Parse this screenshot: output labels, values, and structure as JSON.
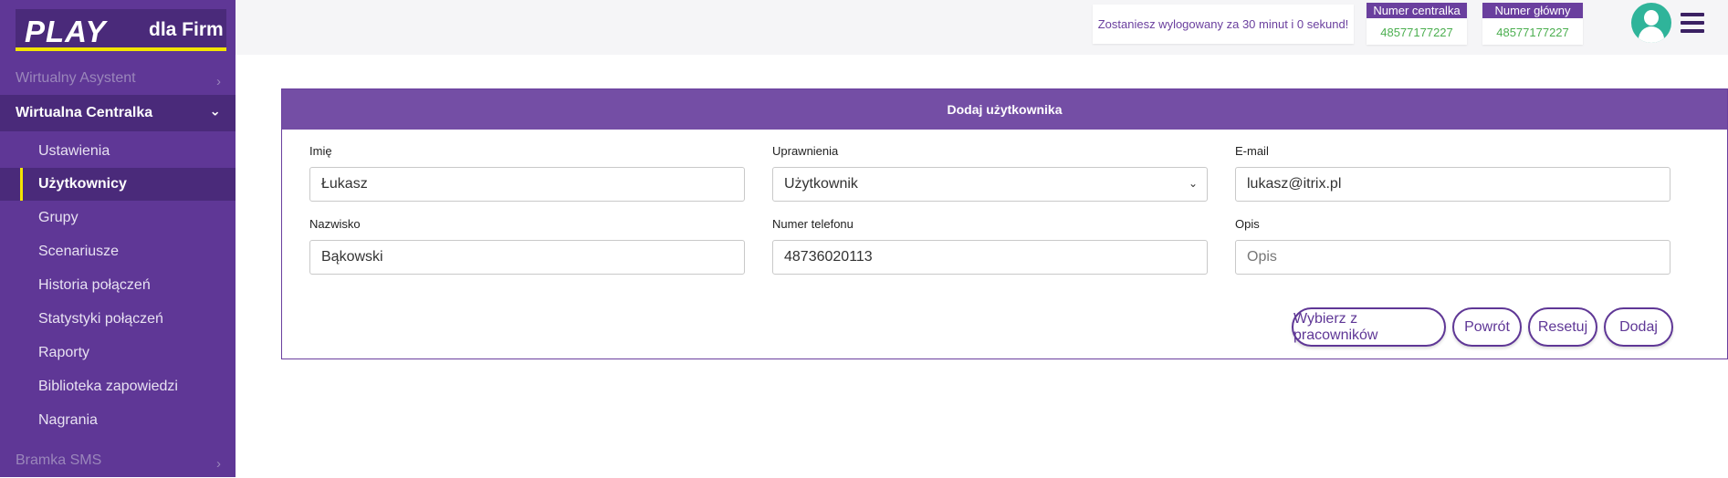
{
  "brand": {
    "name": "PLAY",
    "suffix": "dla Firm",
    "accent": "#f2e400",
    "primary": "#5f3796"
  },
  "sidebar": {
    "items": [
      {
        "label": "Wirtualny Asystent",
        "state": "dim"
      },
      {
        "label": "Wirtualna Centralka",
        "state": "expanded"
      }
    ],
    "subitems": [
      {
        "label": "Ustawienia"
      },
      {
        "label": "Użytkownicy",
        "selected": true
      },
      {
        "label": "Grupy"
      },
      {
        "label": "Scenariusze"
      },
      {
        "label": "Historia połączeń"
      },
      {
        "label": "Statystyki połączeń"
      },
      {
        "label": "Raporty"
      },
      {
        "label": "Biblioteka zapowiedzi"
      },
      {
        "label": "Nagrania"
      }
    ],
    "bottom_item": {
      "label": "Bramka SMS"
    }
  },
  "header": {
    "logout_notice": "Zostaniesz wylogowany za 30 minut i 0 sekund!",
    "central_number": {
      "label": "Numer centralka",
      "value": "48577177227"
    },
    "main_number": {
      "label": "Numer główny",
      "value": "48577177227"
    }
  },
  "form": {
    "title": "Dodaj użytkownika",
    "first_name": {
      "label": "Imię",
      "value": "Łukasz"
    },
    "permissions": {
      "label": "Uprawnienia",
      "value": "Użytkownik"
    },
    "email": {
      "label": "E-mail",
      "value": "lukasz@itrix.pl"
    },
    "last_name": {
      "label": "Nazwisko",
      "value": "Bąkowski"
    },
    "phone": {
      "label": "Numer telefonu",
      "value": "48736020113"
    },
    "description": {
      "label": "Opis",
      "placeholder": "Opis"
    },
    "buttons": {
      "pick_employees": "Wybierz z pracowników",
      "back": "Powrót",
      "reset": "Resetuj",
      "add": "Dodaj"
    }
  },
  "icons": {
    "chevron_right": "›",
    "chevron_down": "⌄",
    "select_arrow": "⌄"
  }
}
